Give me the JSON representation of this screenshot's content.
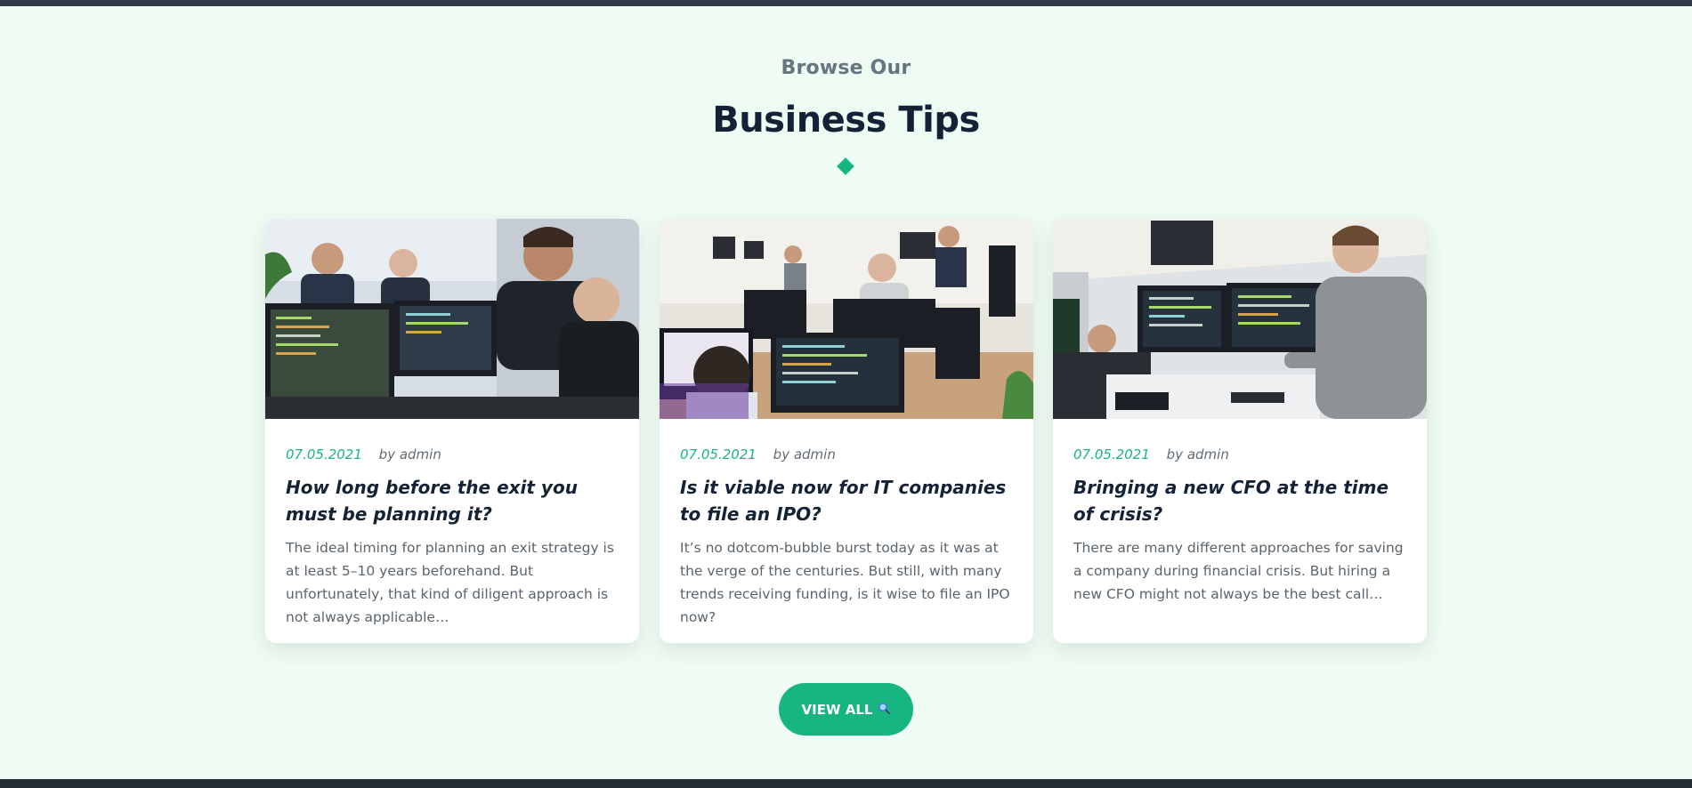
{
  "section": {
    "eyebrow": "Browse Our",
    "title": "Business Tips"
  },
  "posts": [
    {
      "date": "07.05.2021",
      "author": "by admin",
      "title": "How long before the exit you must be planning it?",
      "excerpt": "The ideal timing for planning an exit strategy is at least 5–10 years beforehand. But unfortunately, that kind of diligent approach is not always applicable…"
    },
    {
      "date": "07.05.2021",
      "author": "by admin",
      "title": "Is it viable now for IT companies to file an IPO?",
      "excerpt": "It’s no dotcom-bubble burst today as it was at the verge of the centuries. But still, with many trends receiving funding, is it wise to file an IPO now?"
    },
    {
      "date": "07.05.2021",
      "author": "by admin",
      "title": "Bringing a new CFO at the time of crisis?",
      "excerpt": "There are many different approaches for saving a company during financial crisis. But hiring a new CFO might not always be the best call…"
    }
  ],
  "view_all": {
    "label": "VIEW ALL",
    "icon": "magnifier-icon"
  },
  "colors": {
    "accent": "#17b582",
    "background": "#effcf4",
    "heading": "#132235"
  }
}
